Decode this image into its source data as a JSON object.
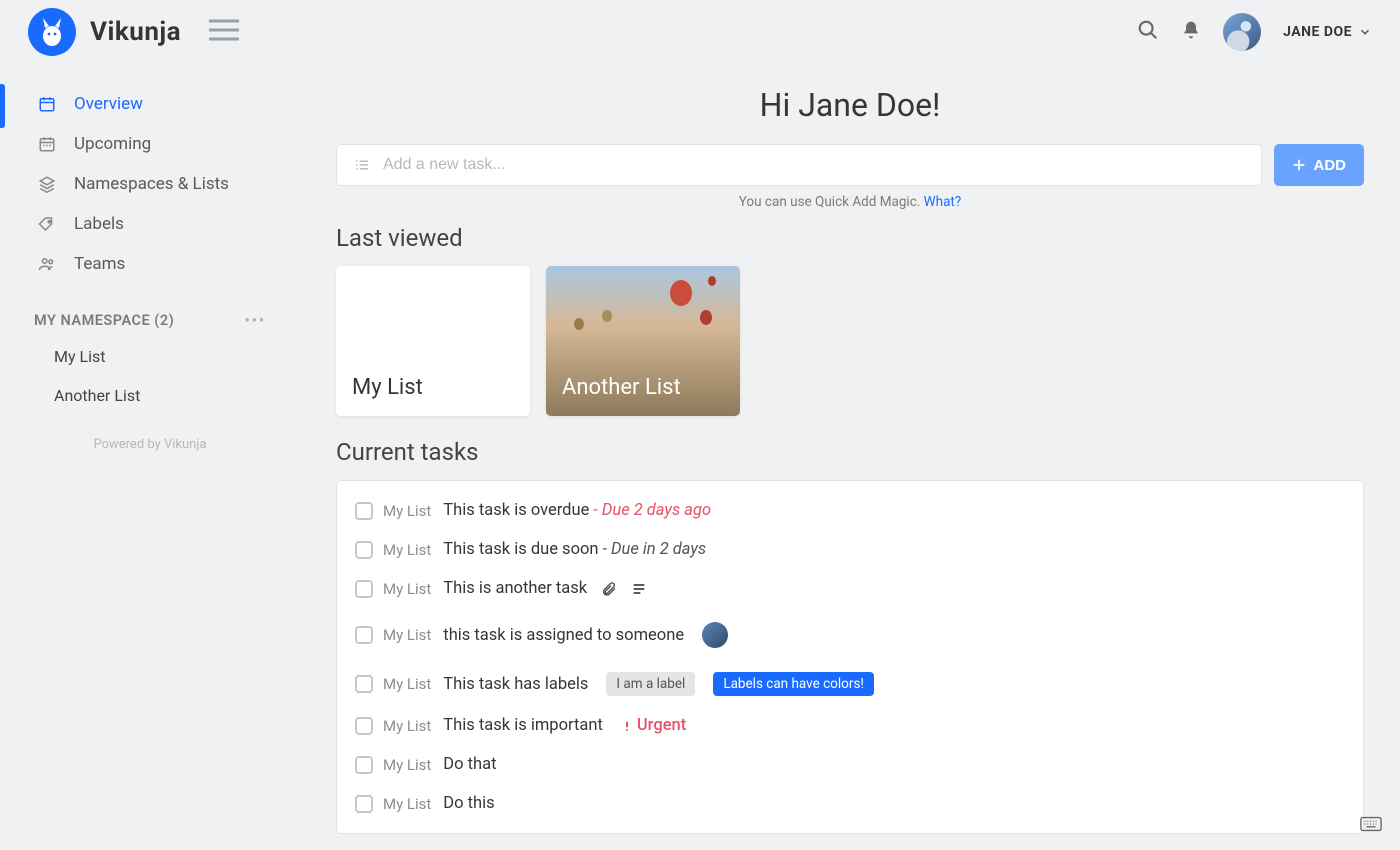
{
  "app": {
    "name": "Vikunja"
  },
  "header": {
    "user_name": "JANE DOE"
  },
  "sidebar": {
    "nav": [
      {
        "label": "Overview"
      },
      {
        "label": "Upcoming"
      },
      {
        "label": "Namespaces & Lists"
      },
      {
        "label": "Labels"
      },
      {
        "label": "Teams"
      }
    ],
    "namespace_heading": "MY NAMESPACE (2)",
    "namespace_lists": [
      {
        "label": "My List"
      },
      {
        "label": "Another List"
      }
    ],
    "powered": "Powered by Vikunja"
  },
  "main": {
    "greeting": "Hi Jane Doe!",
    "add_placeholder": "Add a new task...",
    "add_button": "ADD",
    "magic_hint_prefix": "You can use Quick Add Magic. ",
    "magic_hint_link": "What?",
    "last_viewed_title": "Last viewed",
    "last_viewed": [
      {
        "title": "My List"
      },
      {
        "title": "Another List"
      }
    ],
    "current_tasks_title": "Current tasks",
    "tasks": [
      {
        "list": "My List",
        "title": "This task is overdue",
        "due_sep": " - ",
        "due_text": "Due 2 days ago",
        "overdue": true
      },
      {
        "list": "My List",
        "title": "This task is due soon",
        "due_sep": " - ",
        "due_text": "Due in 2 days",
        "overdue": false
      },
      {
        "list": "My List",
        "title": "This is another task"
      },
      {
        "list": "My List",
        "title": "this task is assigned to someone"
      },
      {
        "list": "My List",
        "title": "This task has labels",
        "labels": [
          {
            "text": "I am a label",
            "variant": "grey"
          },
          {
            "text": "Labels can have colors!",
            "variant": "blue"
          }
        ]
      },
      {
        "list": "My List",
        "title": "This task is important",
        "urgent_text": "Urgent"
      },
      {
        "list": "My List",
        "title": "Do that"
      },
      {
        "list": "My List",
        "title": "Do this"
      }
    ]
  }
}
